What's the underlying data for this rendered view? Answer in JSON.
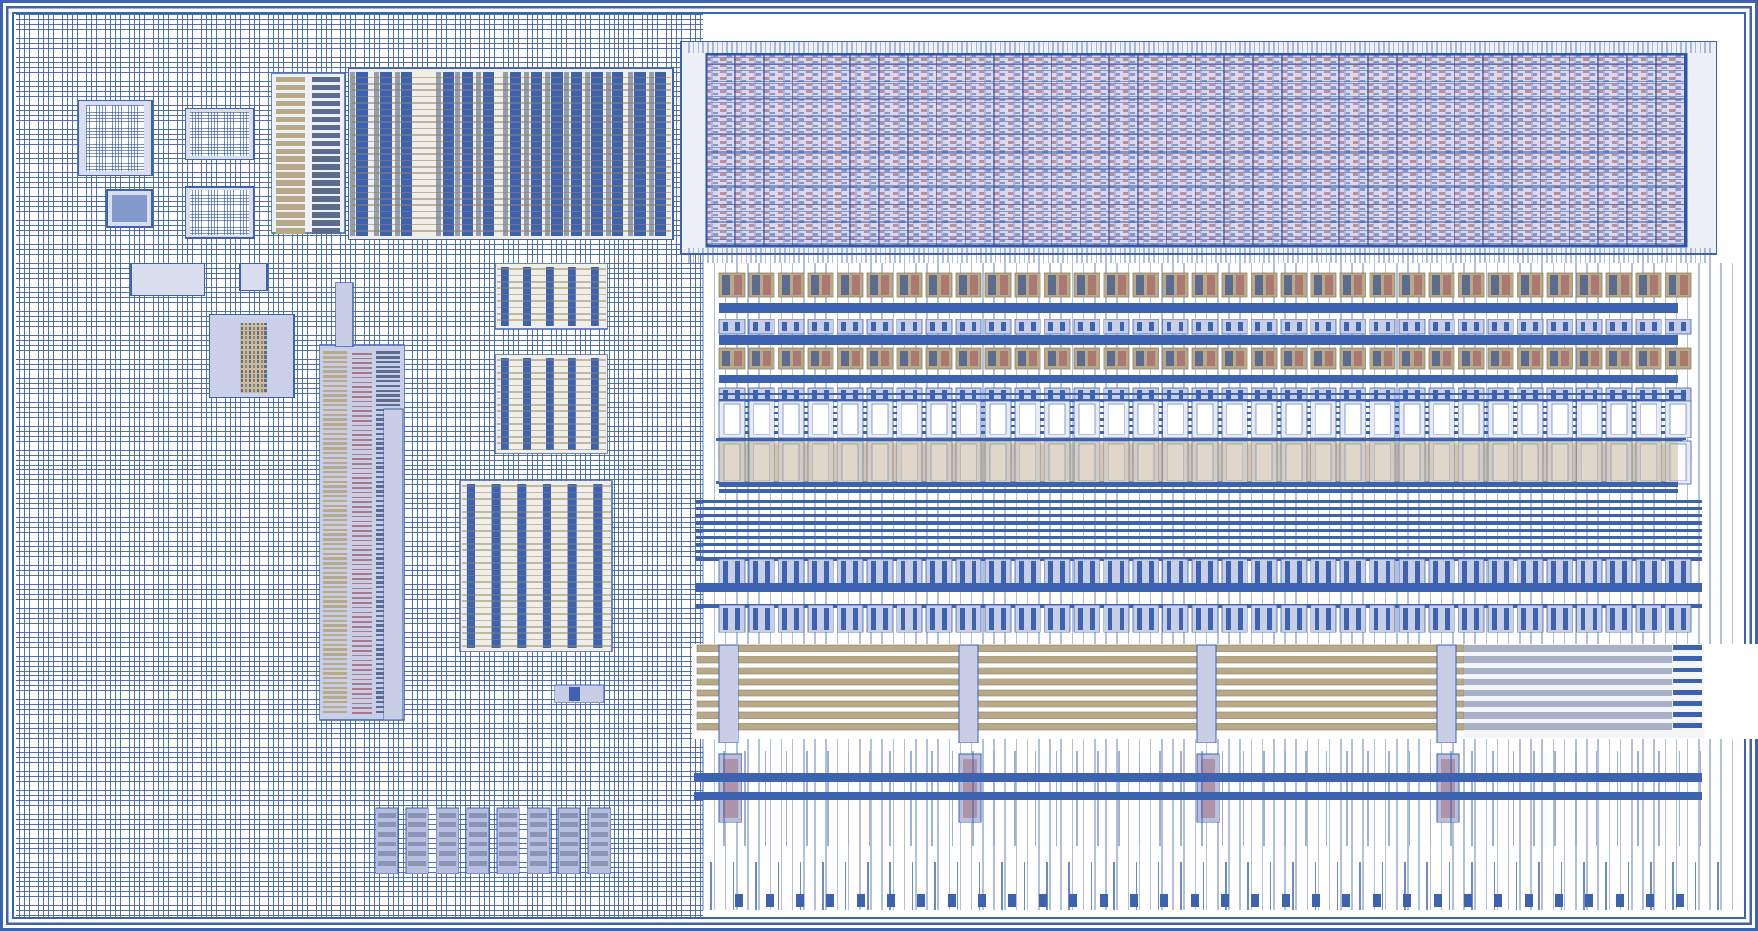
{
  "view": {
    "kind": "ic-layout",
    "colors": {
      "background": "#ffffff",
      "routing": "#3d62b0",
      "routing_dark": "#2d56aa",
      "routing_light": "#a9bde3",
      "cell_fill": "#b8a989",
      "cell_shadow": "#8e8167",
      "poly": "#a0525c",
      "array_tint": "#d9d6e9"
    }
  },
  "texts": []
}
